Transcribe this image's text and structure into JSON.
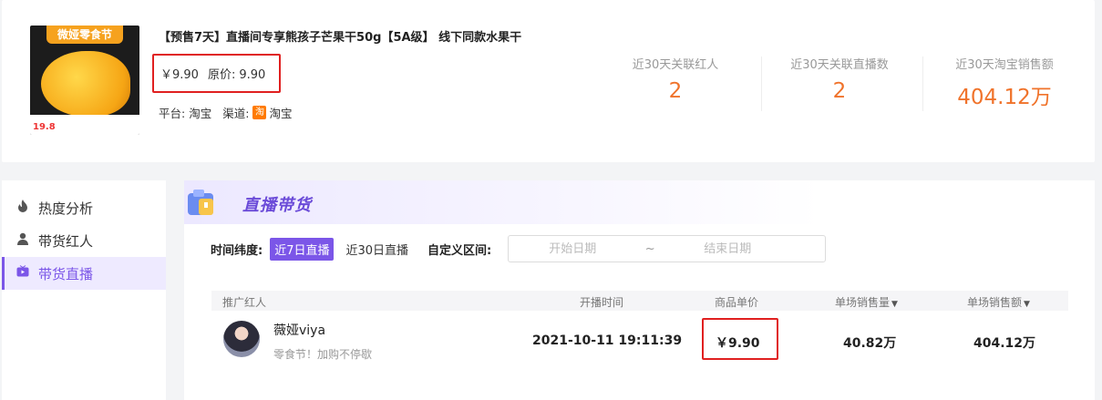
{
  "product": {
    "thumb_banner": "微娅零食节",
    "thumb_price": "19.8",
    "title": "【预售7天】直播间专享熊孩子芒果干50g【5A级】 线下同款水果干",
    "price": "￥9.90",
    "original_price_label": "原价:",
    "original_price": "9.90",
    "platform_label": "平台:",
    "platform": "淘宝",
    "channel_label": "渠道:",
    "channel_icon": "淘",
    "channel": "淘宝"
  },
  "stats": [
    {
      "label": "近30天关联红人",
      "value": "2"
    },
    {
      "label": "近30天关联直播数",
      "value": "2"
    },
    {
      "label": "近30天淘宝销售额",
      "value": "404.12万"
    }
  ],
  "sidebar": {
    "items": [
      {
        "icon": "flame-icon",
        "label": "热度分析"
      },
      {
        "icon": "person-icon",
        "label": "带货红人"
      },
      {
        "icon": "tv-icon",
        "label": "带货直播"
      }
    ],
    "active_index": 2
  },
  "section": {
    "title": "直播带货"
  },
  "filters": {
    "dimension_label": "时间纬度:",
    "options": [
      "近7日直播",
      "近30日直播"
    ],
    "active_option": "近7日直播",
    "custom_range_label": "自定义区间:",
    "start_placeholder": "开始日期",
    "separator": "~",
    "end_placeholder": "结束日期"
  },
  "table": {
    "columns": [
      "推广红人",
      "开播时间",
      "商品单价",
      "单场销售量",
      "单场销售额"
    ],
    "rows": [
      {
        "name": "薇娅viya",
        "desc": "零食节！加购不停歇",
        "start_time": "2021-10-11 19:11:39",
        "unit_price": "￥9.90",
        "sales_volume": "40.82万",
        "sales_amount": "404.12万"
      }
    ]
  },
  "colors": {
    "accent": "#7b56e8",
    "stat_value": "#f0732b",
    "highlight_box": "#e02020"
  }
}
